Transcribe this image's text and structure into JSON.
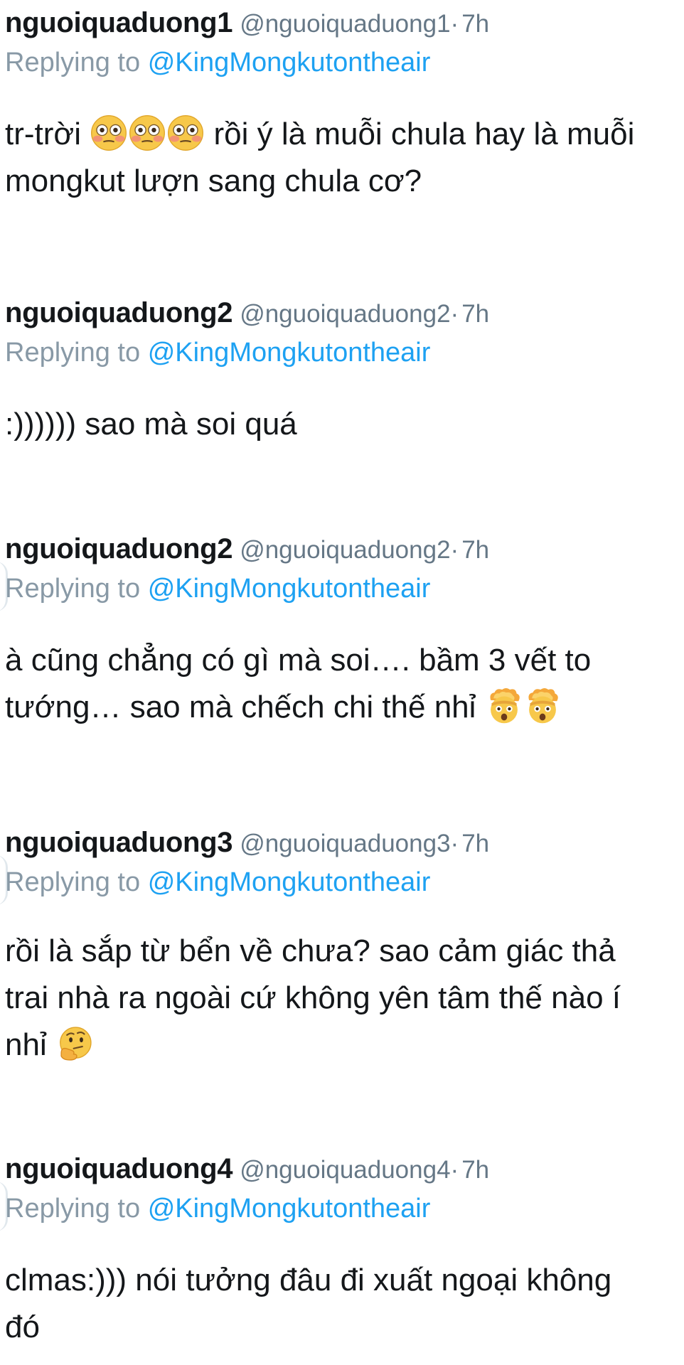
{
  "tweets": [
    {
      "name": "nguoiquaduong1",
      "handle": "@nguoiquaduong1",
      "dot": "·",
      "time": "7h",
      "reply_prefix": "Replying to",
      "reply_to": "@KingMongkutontheair",
      "text_a": "tr-trời",
      "text_b": "rồi ý là muỗi chula hay là muỗi mongkut lượn sang chula cơ?",
      "emojis": [
        "flushed-face",
        "flushed-face",
        "flushed-face"
      ]
    },
    {
      "name": "nguoiquaduong2",
      "handle": "@nguoiquaduong2",
      "dot": "·",
      "time": "7h",
      "reply_prefix": "Replying to",
      "reply_to": "@KingMongkutontheair",
      "text_a": ":)))))) sao mà soi quá"
    },
    {
      "name": "nguoiquaduong2",
      "handle": "@nguoiquaduong2",
      "dot": "·",
      "time": "7h",
      "reply_prefix": "Replying to",
      "reply_to": "@KingMongkutontheair",
      "text_a": "à cũng chẳng có gì mà soi…. bầm 3 vết to tướng… sao mà chếch chi thế nhỉ",
      "emojis": [
        "exploding-head",
        "exploding-head"
      ]
    },
    {
      "name": "nguoiquaduong3",
      "handle": "@nguoiquaduong3",
      "dot": "·",
      "time": "7h",
      "reply_prefix": "Replying to",
      "reply_to": "@KingMongkutontheair",
      "text_a": "rồi là sắp từ bển về chưa? sao cảm giác thả trai nhà ra ngoài cứ không yên tâm thế nào í nhỉ",
      "emojis": [
        "thinking-face"
      ]
    },
    {
      "name": "nguoiquaduong4",
      "handle": "@nguoiquaduong4",
      "dot": "·",
      "time": "7h",
      "reply_prefix": "Replying to",
      "reply_to": "@KingMongkutontheair",
      "text_a": "clmas:))) nói tưởng đâu đi xuất ngoại không đó"
    }
  ],
  "colors": {
    "mention": "#1da1f2",
    "muted": "#657786",
    "text": "#14171a"
  }
}
